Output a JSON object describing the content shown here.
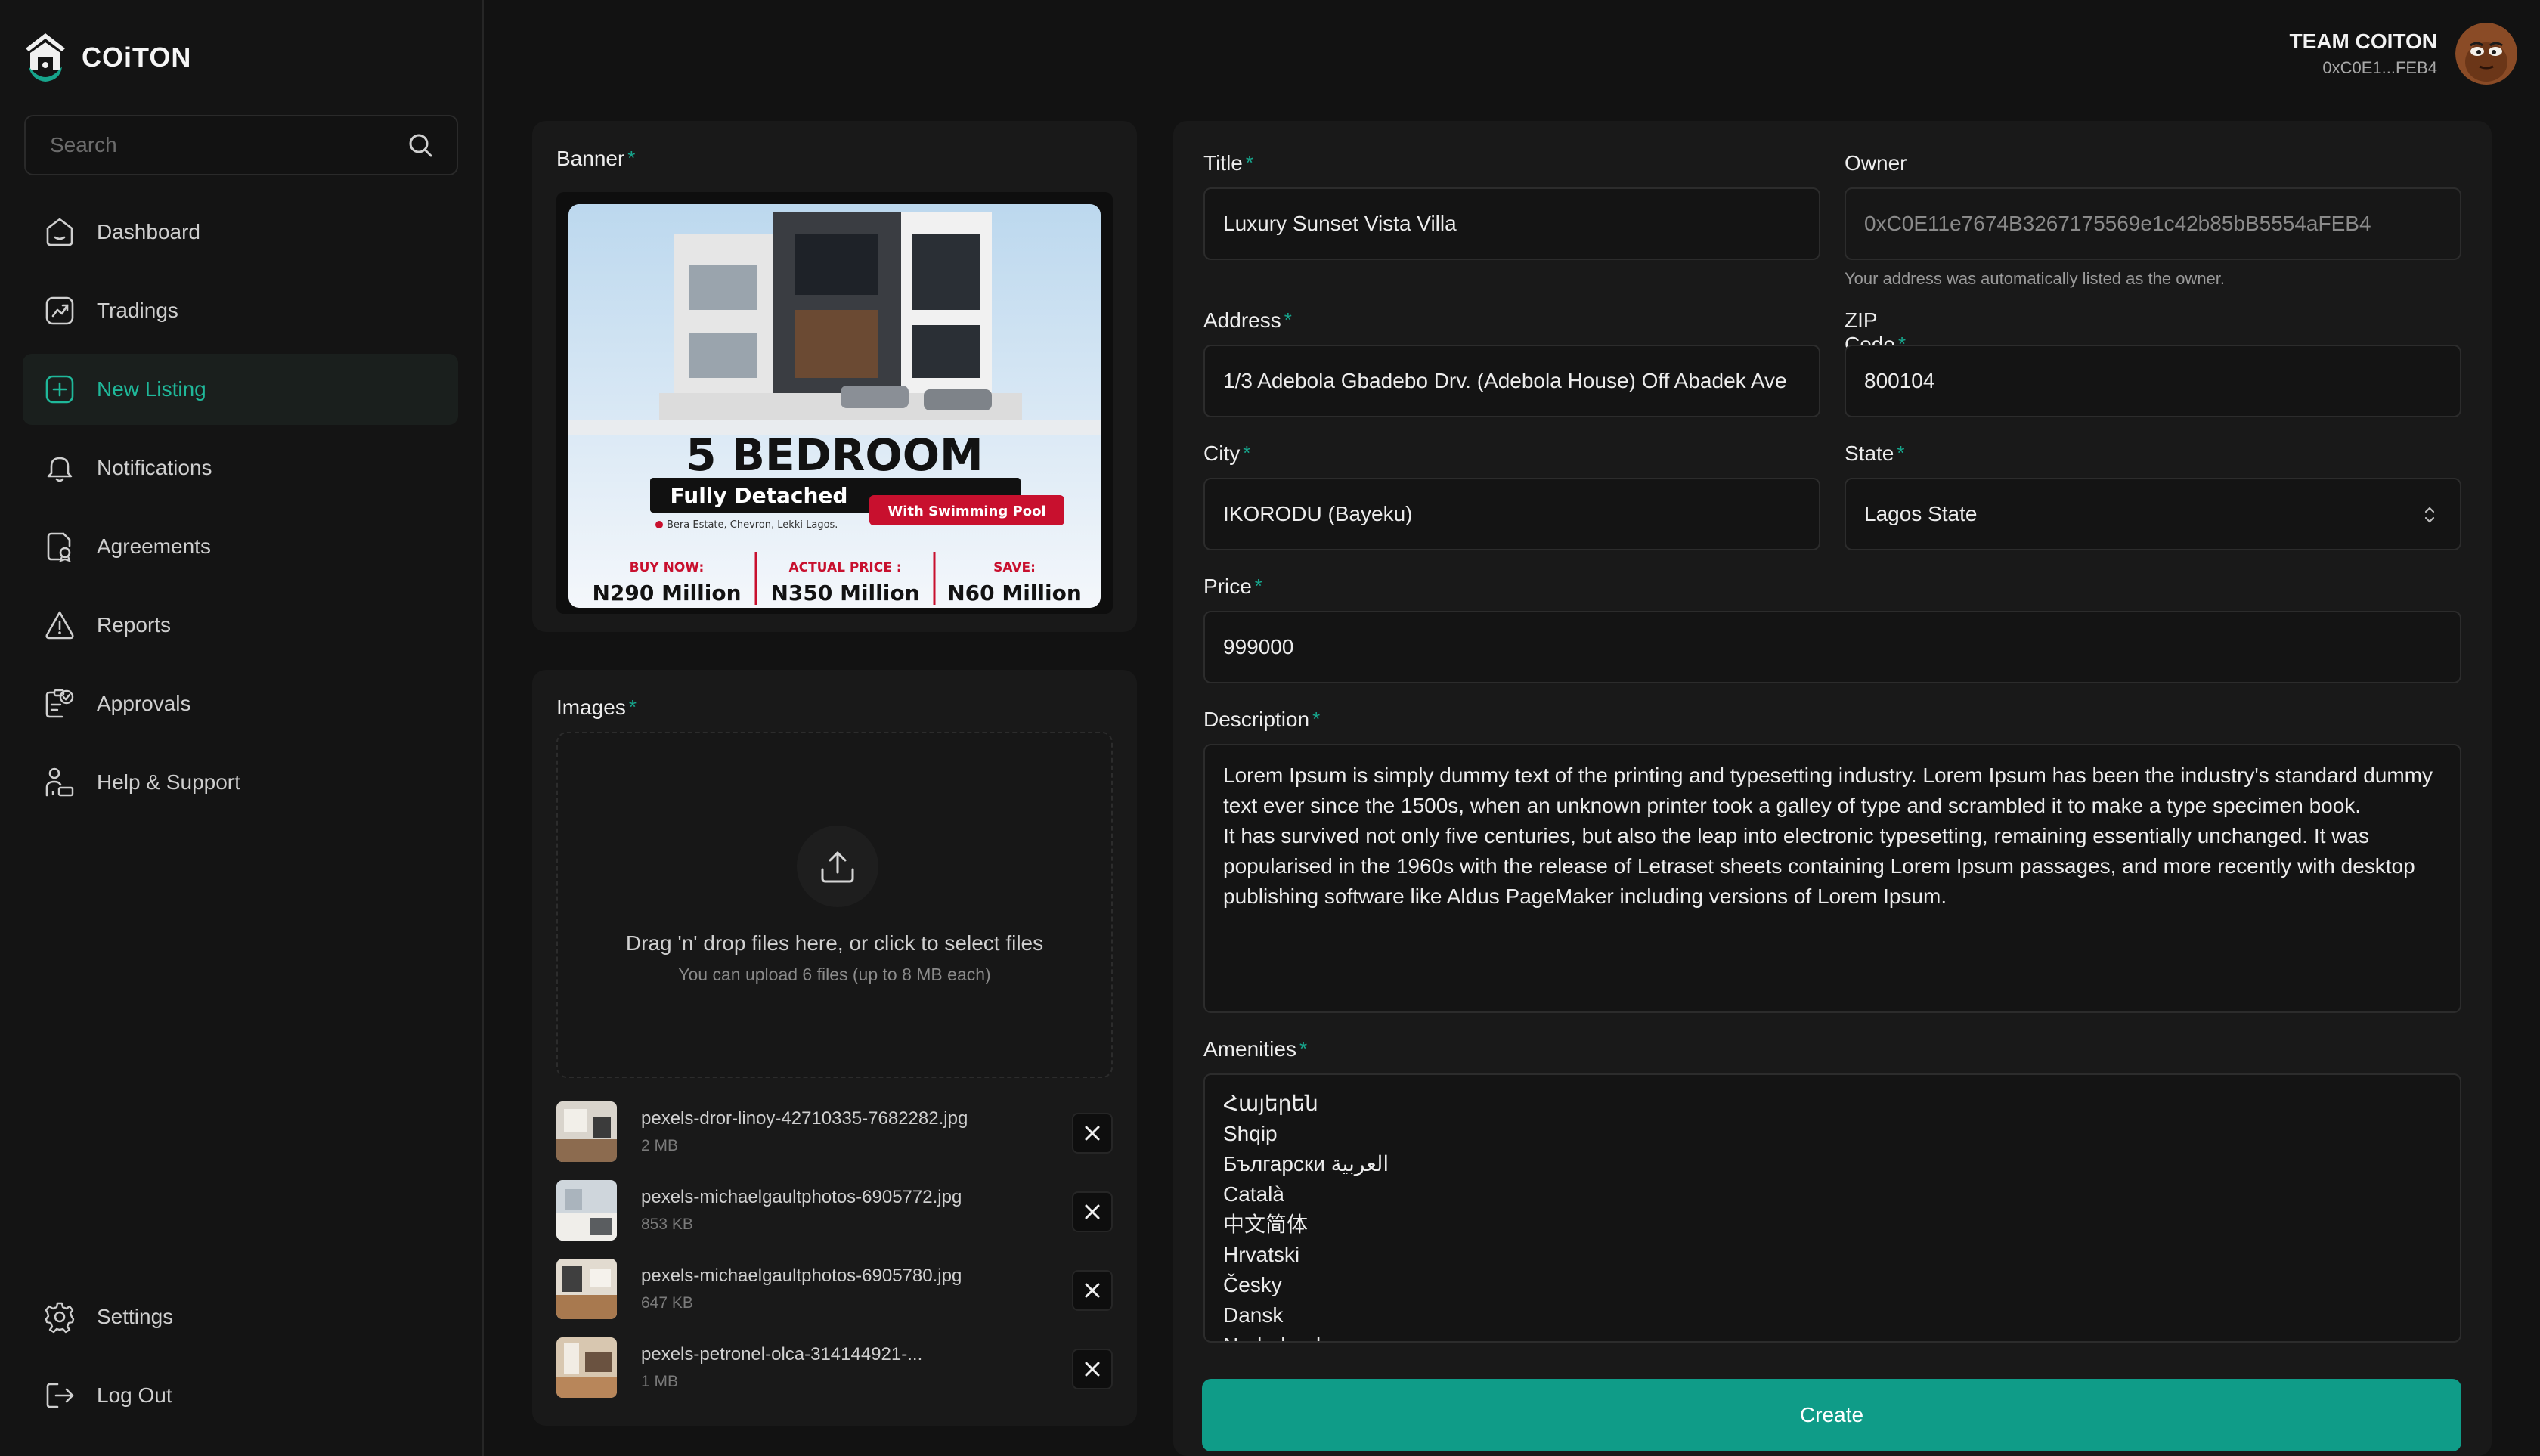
{
  "brand": {
    "name": "COiTON"
  },
  "search": {
    "placeholder": "Search"
  },
  "nav": {
    "items": [
      {
        "label": "Dashboard"
      },
      {
        "label": "Tradings"
      },
      {
        "label": "New Listing"
      },
      {
        "label": "Notifications"
      },
      {
        "label": "Agreements"
      },
      {
        "label": "Reports"
      },
      {
        "label": "Approvals"
      },
      {
        "label": "Help & Support"
      }
    ],
    "bottom": [
      {
        "label": "Settings"
      },
      {
        "label": "Log Out"
      }
    ],
    "active": "New Listing"
  },
  "user": {
    "name": "TEAM COITON",
    "address": "0xC0E1...FEB4"
  },
  "banner": {
    "label": "Banner",
    "image": {
      "headline": "5 BEDROOM",
      "subhead": "Fully Detached",
      "tag": "With Swimming Pool",
      "location": "Bera Estate, Chevron, Lekki Lagos.",
      "prices": [
        {
          "label": "BUY NOW:",
          "value": "N290 Million"
        },
        {
          "label": "ACTUAL PRICE :",
          "value": "N350 Million"
        },
        {
          "label": "SAVE:",
          "value": "N60 Million"
        }
      ]
    }
  },
  "images": {
    "label": "Images",
    "dropzone_title": "Drag 'n' drop files here, or click to select files",
    "dropzone_subtitle": "You can upload 6 files (up to 8 MB each)",
    "files": [
      {
        "name": "pexels-dror-linoy-42710335-7682282.jpg",
        "size": "2 MB"
      },
      {
        "name": "pexels-michaelgaultphotos-6905772.jpg",
        "size": "853 KB"
      },
      {
        "name": "pexels-michaelgaultphotos-6905780.jpg",
        "size": "647 KB"
      },
      {
        "name": "pexels-petronel-olca-314144921-...",
        "size": "1 MB"
      }
    ]
  },
  "form": {
    "title": {
      "label": "Title",
      "value": "Luxury Sunset Vista Villa"
    },
    "owner": {
      "label": "Owner",
      "value": "0xC0E11e7674B3267175569e1c42b85bB5554aFEB4",
      "helper": "Your address was automatically listed as the owner."
    },
    "address": {
      "label": "Address",
      "value": "1/3 Adebola Gbadebo Drv. (Adebola House) Off Abadek Ave"
    },
    "zip": {
      "label": "ZIP Code",
      "value": "800104"
    },
    "city": {
      "label": "City",
      "value": "IKORODU (Bayeku)"
    },
    "state": {
      "label": "State",
      "value": "Lagos State"
    },
    "price": {
      "label": "Price",
      "value": "999000"
    },
    "description": {
      "label": "Description",
      "value": "Lorem Ipsum is simply dummy text of the printing and typesetting industry. Lorem Ipsum has been the industry's standard dummy text ever since the 1500s, when an unknown printer took a galley of type and scrambled it to make a type specimen book.\nIt has survived not only five centuries, but also the leap into electronic typesetting, remaining essentially unchanged. It was popularised in the 1960s with the release of Letraset sheets containing Lorem Ipsum passages, and more recently with desktop publishing software like Aldus PageMaker including versions of Lorem Ipsum."
    },
    "amenities": {
      "label": "Amenities",
      "value": "Հայերեն\nShqip\nБългарски العربية\nCatalà\n中文简体\nHrvatski\nČesky\nDansk\nNederlands"
    },
    "submit_label": "Create"
  },
  "colors": {
    "accent": "#17A58C",
    "button": "#0F9C88",
    "background": "#121212",
    "card": "#191919"
  }
}
